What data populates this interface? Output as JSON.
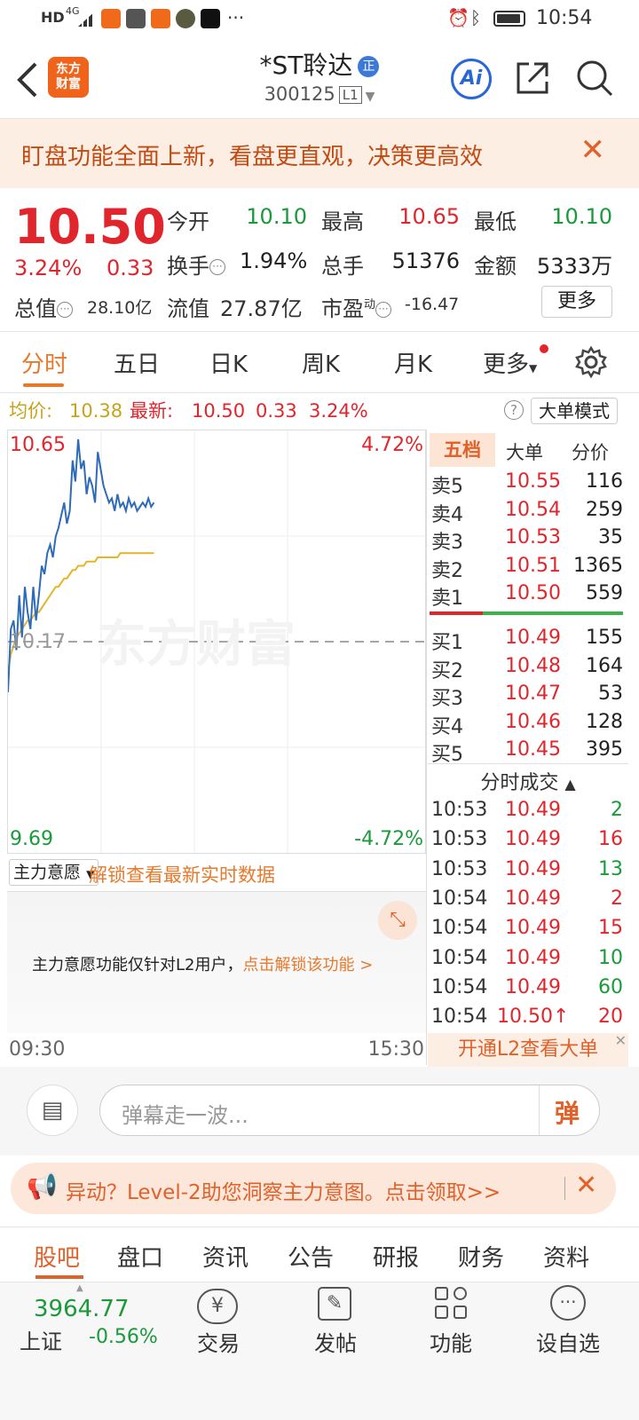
{
  "status_bar": {
    "time": "10:54",
    "left_text": "HD",
    "network": "4G",
    "more": "···"
  },
  "header": {
    "title": "*ST聆达",
    "title_tag": "正",
    "code": "300125",
    "level": "L1",
    "logo_line1": "东方",
    "logo_line2": "财富",
    "ai_label": "Ai"
  },
  "banner": {
    "text": "盯盘功能全面上新，看盘更直观，决策更高效",
    "close": "✕"
  },
  "quote": {
    "price": "10.50",
    "change_pct": "3.24%",
    "change": "0.33",
    "open_label": "今开",
    "open": "10.10",
    "high_label": "最高",
    "high": "10.65",
    "low_label": "最低",
    "low": "10.10",
    "turnover_label": "换手",
    "turnover": "1.94%",
    "volume_label": "总手",
    "volume": "51376",
    "amount_label": "金额",
    "amount": "5333万",
    "mktcap_label": "总值",
    "mktcap": "28.10亿",
    "float_label": "流值",
    "float_cap": "27.87亿",
    "pe_label": "市盈",
    "pe_sup": "动",
    "pe": "-16.47",
    "more_label": "更多"
  },
  "tabs": [
    "分时",
    "五日",
    "日K",
    "周K",
    "月K",
    "更多"
  ],
  "summary": {
    "avg_label": "均价:",
    "avg": "10.38",
    "last_label": "最新:",
    "last": "10.50",
    "chg": "0.33",
    "pct": "3.24%",
    "mode_label": "大单模式",
    "help": "?"
  },
  "chart": {
    "top_price": "10.65",
    "top_pct": "4.72%",
    "mid_price": "10.17",
    "bottom_price": "9.69",
    "bottom_pct": "-4.72%",
    "watermark": "东方财富",
    "start_time": "09:30",
    "end_time": "15:30"
  },
  "chart_data": {
    "type": "line",
    "ylim": [
      9.69,
      10.65
    ],
    "ref_price": 10.17,
    "x_range": [
      "09:30",
      "15:30"
    ],
    "series": [
      {
        "name": "最新",
        "color": "#2e6bb8",
        "values": [
          10.05,
          10.2,
          10.22,
          10.15,
          10.28,
          10.18,
          10.3,
          10.24,
          10.2,
          10.3,
          10.22,
          10.28,
          10.35,
          10.33,
          10.38,
          10.4,
          10.37,
          10.42,
          10.44,
          10.47,
          10.5,
          10.45,
          10.48,
          10.6,
          10.55,
          10.65,
          10.58,
          10.6,
          10.52,
          10.56,
          10.54,
          10.5,
          10.62,
          10.58,
          10.54,
          10.52,
          10.5,
          10.51,
          10.48,
          10.52,
          10.49,
          10.5,
          10.48,
          10.51,
          10.49,
          10.5,
          10.48,
          10.49,
          10.5,
          10.49,
          10.51,
          10.49,
          10.5
        ]
      },
      {
        "name": "均价",
        "color": "#e6b42a",
        "values": [
          10.1,
          10.14,
          10.16,
          10.18,
          10.19,
          10.2,
          10.21,
          10.22,
          10.22,
          10.23,
          10.24,
          10.24,
          10.25,
          10.26,
          10.27,
          10.28,
          10.29,
          10.3,
          10.3,
          10.31,
          10.32,
          10.32,
          10.33,
          10.34,
          10.34,
          10.35,
          10.35,
          10.35,
          10.36,
          10.36,
          10.36,
          10.36,
          10.37,
          10.37,
          10.37,
          10.37,
          10.37,
          10.37,
          10.37,
          10.37,
          10.38,
          10.38,
          10.38,
          10.38,
          10.38,
          10.38,
          10.38,
          10.38,
          10.38,
          10.38,
          10.38,
          10.38,
          10.38
        ]
      }
    ]
  },
  "orderbook": {
    "tabs": [
      "五档",
      "大单",
      "分价"
    ],
    "asks": [
      {
        "label": "卖5",
        "price": "10.55",
        "vol": "116"
      },
      {
        "label": "卖4",
        "price": "10.54",
        "vol": "259"
      },
      {
        "label": "卖3",
        "price": "10.53",
        "vol": "35"
      },
      {
        "label": "卖2",
        "price": "10.51",
        "vol": "1365"
      },
      {
        "label": "卖1",
        "price": "10.50",
        "vol": "559"
      }
    ],
    "bids": [
      {
        "label": "买1",
        "price": "10.49",
        "vol": "155"
      },
      {
        "label": "买2",
        "price": "10.48",
        "vol": "164"
      },
      {
        "label": "买3",
        "price": "10.47",
        "vol": "53"
      },
      {
        "label": "买4",
        "price": "10.46",
        "vol": "128"
      },
      {
        "label": "买5",
        "price": "10.45",
        "vol": "395"
      }
    ],
    "ticks_title": "分时成交",
    "ticks": [
      {
        "time": "10:53",
        "price": "10.49",
        "vol": "2",
        "dir": "sell"
      },
      {
        "time": "10:53",
        "price": "10.49",
        "vol": "16",
        "dir": "buy"
      },
      {
        "time": "10:53",
        "price": "10.49",
        "vol": "13",
        "dir": "sell"
      },
      {
        "time": "10:54",
        "price": "10.49",
        "vol": "2",
        "dir": "buy"
      },
      {
        "time": "10:54",
        "price": "10.49",
        "vol": "15",
        "dir": "buy"
      },
      {
        "time": "10:54",
        "price": "10.49",
        "vol": "10",
        "dir": "sell"
      },
      {
        "time": "10:54",
        "price": "10.49",
        "vol": "60",
        "dir": "sell"
      },
      {
        "time": "10:54",
        "price": "10.50↑",
        "vol": "20",
        "dir": "buy"
      }
    ],
    "l2_promo": "开通L2查看大单"
  },
  "mainforce": {
    "select_label": "主力意愿",
    "unlock_text": "解锁查看最新实时数据",
    "notice": "主力意愿功能仅针对L2用户，",
    "notice_link": "点击解锁该功能 >"
  },
  "danmu": {
    "placeholder": "弹幕走一波...",
    "send": "弹"
  },
  "notice_bar": {
    "text": "异动？Level-2助您洞察主力意图。点击领取>>"
  },
  "bottom_tabs": [
    "股吧",
    "盘口",
    "资讯",
    "公告",
    "研报",
    "财务",
    "资料"
  ],
  "bottom_nav": {
    "index_value": "3964.77",
    "index_name": "上证",
    "index_pct": "-0.56%",
    "items": [
      "交易",
      "发帖",
      "功能",
      "设自选"
    ]
  }
}
